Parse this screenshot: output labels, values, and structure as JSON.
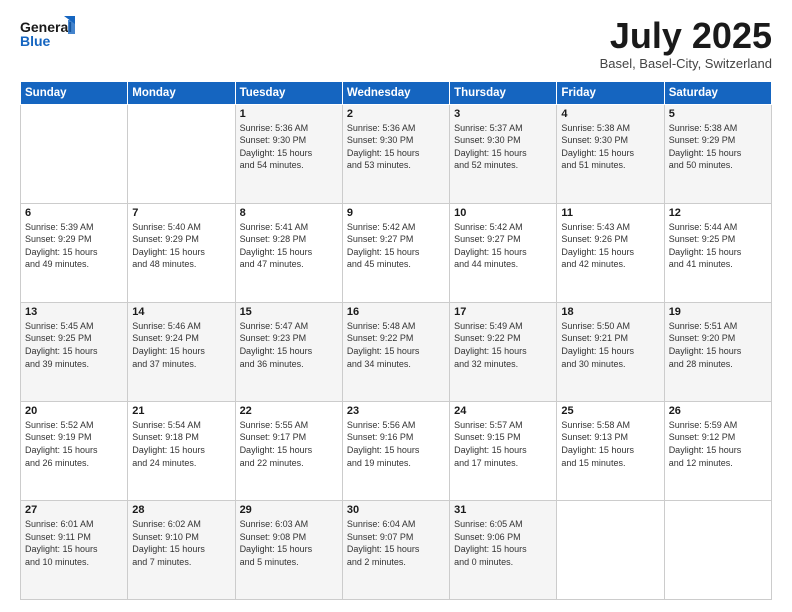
{
  "logo": {
    "line1": "General",
    "line2": "Blue"
  },
  "title": "July 2025",
  "location": "Basel, Basel-City, Switzerland",
  "headers": [
    "Sunday",
    "Monday",
    "Tuesday",
    "Wednesday",
    "Thursday",
    "Friday",
    "Saturday"
  ],
  "weeks": [
    [
      {
        "day": "",
        "info": ""
      },
      {
        "day": "",
        "info": ""
      },
      {
        "day": "1",
        "info": "Sunrise: 5:36 AM\nSunset: 9:30 PM\nDaylight: 15 hours\nand 54 minutes."
      },
      {
        "day": "2",
        "info": "Sunrise: 5:36 AM\nSunset: 9:30 PM\nDaylight: 15 hours\nand 53 minutes."
      },
      {
        "day": "3",
        "info": "Sunrise: 5:37 AM\nSunset: 9:30 PM\nDaylight: 15 hours\nand 52 minutes."
      },
      {
        "day": "4",
        "info": "Sunrise: 5:38 AM\nSunset: 9:30 PM\nDaylight: 15 hours\nand 51 minutes."
      },
      {
        "day": "5",
        "info": "Sunrise: 5:38 AM\nSunset: 9:29 PM\nDaylight: 15 hours\nand 50 minutes."
      }
    ],
    [
      {
        "day": "6",
        "info": "Sunrise: 5:39 AM\nSunset: 9:29 PM\nDaylight: 15 hours\nand 49 minutes."
      },
      {
        "day": "7",
        "info": "Sunrise: 5:40 AM\nSunset: 9:29 PM\nDaylight: 15 hours\nand 48 minutes."
      },
      {
        "day": "8",
        "info": "Sunrise: 5:41 AM\nSunset: 9:28 PM\nDaylight: 15 hours\nand 47 minutes."
      },
      {
        "day": "9",
        "info": "Sunrise: 5:42 AM\nSunset: 9:27 PM\nDaylight: 15 hours\nand 45 minutes."
      },
      {
        "day": "10",
        "info": "Sunrise: 5:42 AM\nSunset: 9:27 PM\nDaylight: 15 hours\nand 44 minutes."
      },
      {
        "day": "11",
        "info": "Sunrise: 5:43 AM\nSunset: 9:26 PM\nDaylight: 15 hours\nand 42 minutes."
      },
      {
        "day": "12",
        "info": "Sunrise: 5:44 AM\nSunset: 9:25 PM\nDaylight: 15 hours\nand 41 minutes."
      }
    ],
    [
      {
        "day": "13",
        "info": "Sunrise: 5:45 AM\nSunset: 9:25 PM\nDaylight: 15 hours\nand 39 minutes."
      },
      {
        "day": "14",
        "info": "Sunrise: 5:46 AM\nSunset: 9:24 PM\nDaylight: 15 hours\nand 37 minutes."
      },
      {
        "day": "15",
        "info": "Sunrise: 5:47 AM\nSunset: 9:23 PM\nDaylight: 15 hours\nand 36 minutes."
      },
      {
        "day": "16",
        "info": "Sunrise: 5:48 AM\nSunset: 9:22 PM\nDaylight: 15 hours\nand 34 minutes."
      },
      {
        "day": "17",
        "info": "Sunrise: 5:49 AM\nSunset: 9:22 PM\nDaylight: 15 hours\nand 32 minutes."
      },
      {
        "day": "18",
        "info": "Sunrise: 5:50 AM\nSunset: 9:21 PM\nDaylight: 15 hours\nand 30 minutes."
      },
      {
        "day": "19",
        "info": "Sunrise: 5:51 AM\nSunset: 9:20 PM\nDaylight: 15 hours\nand 28 minutes."
      }
    ],
    [
      {
        "day": "20",
        "info": "Sunrise: 5:52 AM\nSunset: 9:19 PM\nDaylight: 15 hours\nand 26 minutes."
      },
      {
        "day": "21",
        "info": "Sunrise: 5:54 AM\nSunset: 9:18 PM\nDaylight: 15 hours\nand 24 minutes."
      },
      {
        "day": "22",
        "info": "Sunrise: 5:55 AM\nSunset: 9:17 PM\nDaylight: 15 hours\nand 22 minutes."
      },
      {
        "day": "23",
        "info": "Sunrise: 5:56 AM\nSunset: 9:16 PM\nDaylight: 15 hours\nand 19 minutes."
      },
      {
        "day": "24",
        "info": "Sunrise: 5:57 AM\nSunset: 9:15 PM\nDaylight: 15 hours\nand 17 minutes."
      },
      {
        "day": "25",
        "info": "Sunrise: 5:58 AM\nSunset: 9:13 PM\nDaylight: 15 hours\nand 15 minutes."
      },
      {
        "day": "26",
        "info": "Sunrise: 5:59 AM\nSunset: 9:12 PM\nDaylight: 15 hours\nand 12 minutes."
      }
    ],
    [
      {
        "day": "27",
        "info": "Sunrise: 6:01 AM\nSunset: 9:11 PM\nDaylight: 15 hours\nand 10 minutes."
      },
      {
        "day": "28",
        "info": "Sunrise: 6:02 AM\nSunset: 9:10 PM\nDaylight: 15 hours\nand 7 minutes."
      },
      {
        "day": "29",
        "info": "Sunrise: 6:03 AM\nSunset: 9:08 PM\nDaylight: 15 hours\nand 5 minutes."
      },
      {
        "day": "30",
        "info": "Sunrise: 6:04 AM\nSunset: 9:07 PM\nDaylight: 15 hours\nand 2 minutes."
      },
      {
        "day": "31",
        "info": "Sunrise: 6:05 AM\nSunset: 9:06 PM\nDaylight: 15 hours\nand 0 minutes."
      },
      {
        "day": "",
        "info": ""
      },
      {
        "day": "",
        "info": ""
      }
    ]
  ]
}
